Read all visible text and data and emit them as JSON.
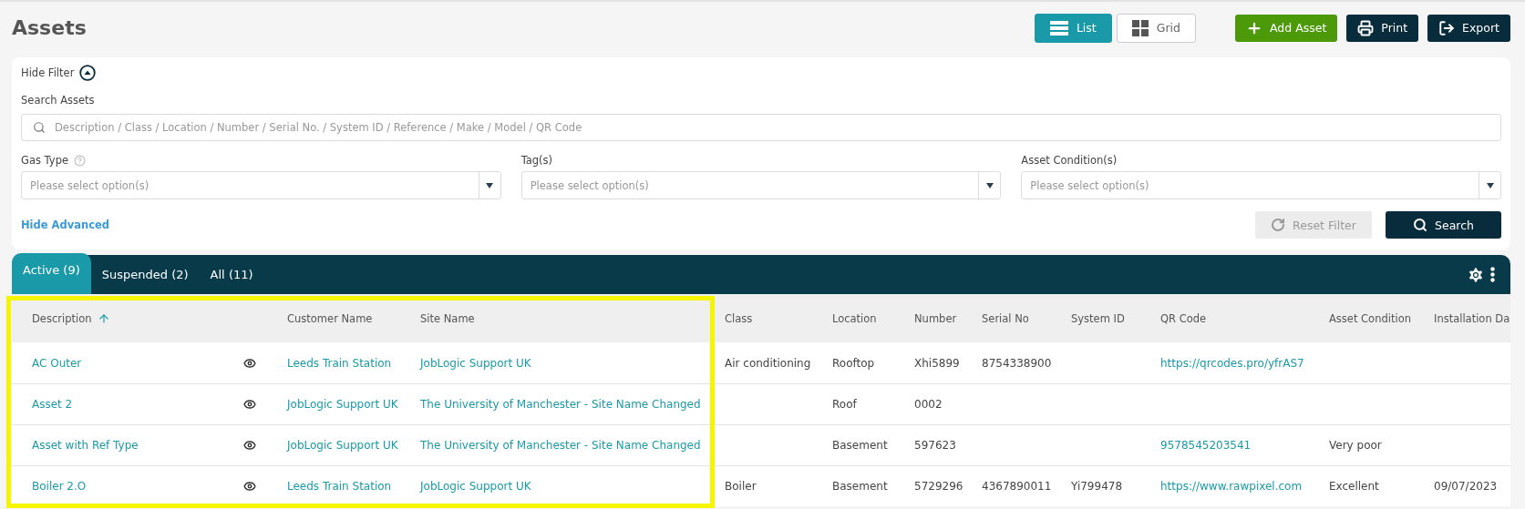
{
  "page": {
    "title": "Assets"
  },
  "view_toggle": [
    {
      "label": "List",
      "kind": "list",
      "selected": true
    },
    {
      "label": "Grid",
      "kind": "grid",
      "selected": false
    }
  ],
  "actions": [
    {
      "label": "Add Asset",
      "kind": "add"
    },
    {
      "label": "Print",
      "kind": "print"
    },
    {
      "label": "Export",
      "kind": "export"
    }
  ],
  "filter": {
    "toggle_label": "Hide Filter",
    "expanded": true,
    "search_label": "Search Assets",
    "search_placeholder": "Description / Class / Location / Number / Serial No. / System ID / Reference / Make / Model / QR Code",
    "selects": [
      {
        "label": "Gas Type",
        "help": true,
        "placeholder": "Please select option(s)"
      },
      {
        "label": "Tag(s)",
        "help": false,
        "placeholder": "Please select option(s)"
      },
      {
        "label": "Asset Condition(s)",
        "help": false,
        "placeholder": "Please select option(s)"
      }
    ],
    "advanced_link": "Hide Advanced",
    "reset_button": {
      "label": "Reset Filter",
      "disabled": true
    },
    "search_button": "Search"
  },
  "tabs": [
    {
      "label": "Active",
      "count": "(9)",
      "selected": true
    },
    {
      "label": "Suspended",
      "count": "(2)",
      "selected": false
    },
    {
      "label": "All",
      "count": "(11)",
      "selected": false
    }
  ],
  "table": {
    "highlight": true,
    "columns": [
      {
        "label": "Description",
        "kind": "link",
        "sorted": true
      },
      {
        "label": "Customer Name",
        "kind": "link"
      },
      {
        "label": "Site Name",
        "kind": "link"
      },
      {
        "label": "Class",
        "kind": "text"
      },
      {
        "label": "Location",
        "kind": "text"
      },
      {
        "label": "Number",
        "kind": "text"
      },
      {
        "label": "Serial No",
        "kind": "text"
      },
      {
        "label": "System ID",
        "kind": "text"
      },
      {
        "label": "QR Code",
        "kind": "link"
      },
      {
        "label": "Asset Condition",
        "kind": "text"
      },
      {
        "label": "Installation Da",
        "kind": "text"
      }
    ],
    "rows": [
      {
        "cells": [
          "AC Outer",
          "Leeds Train Station",
          "JobLogic Support UK",
          "Air conditioning",
          "Rooftop",
          "Xhi5899",
          "8754338900",
          null,
          "https://qrcodes.pro/yfrAS7",
          null,
          null
        ]
      },
      {
        "cells": [
          "Asset 2",
          "JobLogic Support UK",
          "The University of Manchester - Site Name Changed",
          null,
          "Roof",
          "0002",
          null,
          null,
          null,
          null,
          null
        ]
      },
      {
        "cells": [
          "Asset with Ref Type",
          "JobLogic Support UK",
          "The University of Manchester - Site Name Changed",
          null,
          "Basement",
          "597623",
          null,
          null,
          "9578545203541",
          "Very poor",
          null
        ]
      },
      {
        "cells": [
          "Boiler 2.O",
          "Leeds Train Station",
          "JobLogic Support UK",
          "Boiler",
          "Basement",
          "5729296",
          "4367890011",
          "Yi799478",
          "https://www.rawpixel.com",
          "Excellent",
          "09/07/2023"
        ]
      }
    ]
  }
}
